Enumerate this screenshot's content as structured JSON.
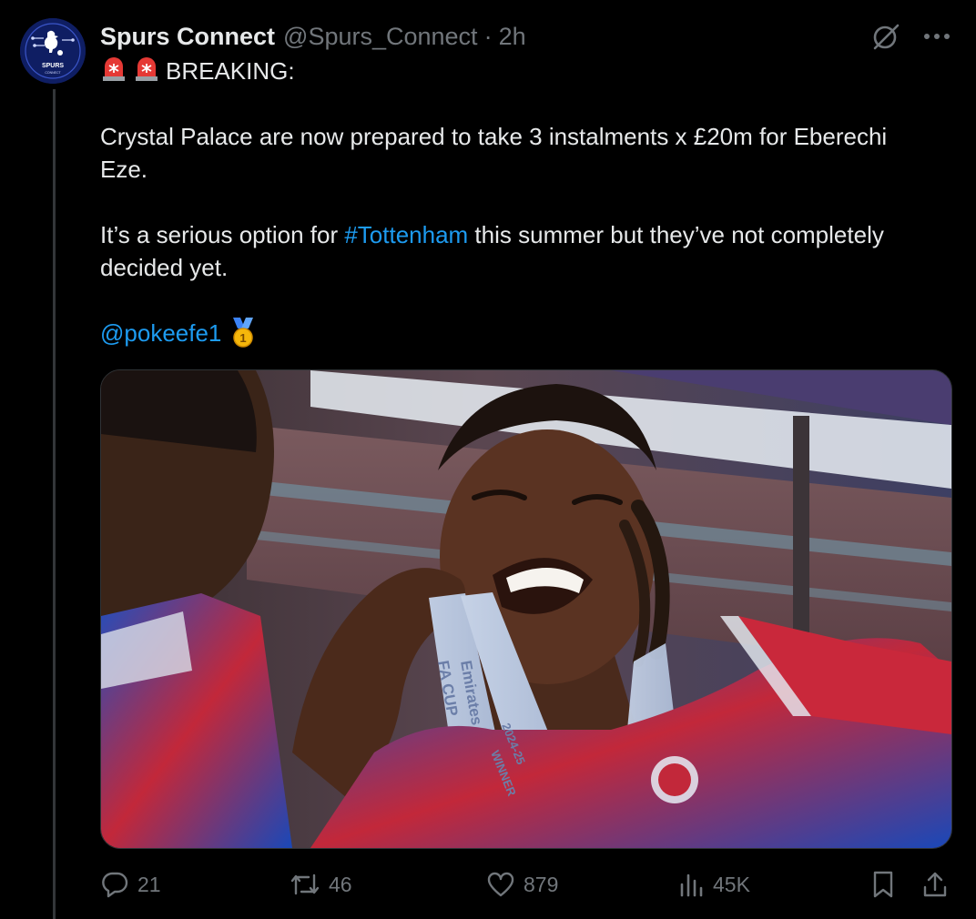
{
  "author": {
    "display_name": "Spurs Connect",
    "handle": "@Spurs_Connect",
    "separator": "·",
    "time": "2h",
    "avatar_text": "SPURS",
    "avatar_subtext": "CONNECT"
  },
  "tweet": {
    "breaking": "BREAKING:",
    "para1_line1": "Crystal Palace are now prepared to take 3 instalments x £20m for Eberechi",
    "para1_line2": "Eze.",
    "para2_pre": "It’s a serious option for ",
    "hashtag": "#Tottenham",
    "para2_post": " this summer but they’ve not completely",
    "para2_line2": "decided yet.",
    "mention": "@pokeefe1",
    "medal_number": "1"
  },
  "media": {
    "ribbon_text_1": "Emirates",
    "ribbon_text_2": "FA CUP",
    "ribbon_text_3": "2024-25",
    "ribbon_text_4": "WINNER"
  },
  "actions": {
    "replies": "21",
    "reposts": "46",
    "likes": "879",
    "views": "45K"
  },
  "colors": {
    "background": "#000000",
    "text": "#e7e9ea",
    "muted": "#71767b",
    "link": "#1d9bf0",
    "avatar_bg": "#0f1e63"
  }
}
